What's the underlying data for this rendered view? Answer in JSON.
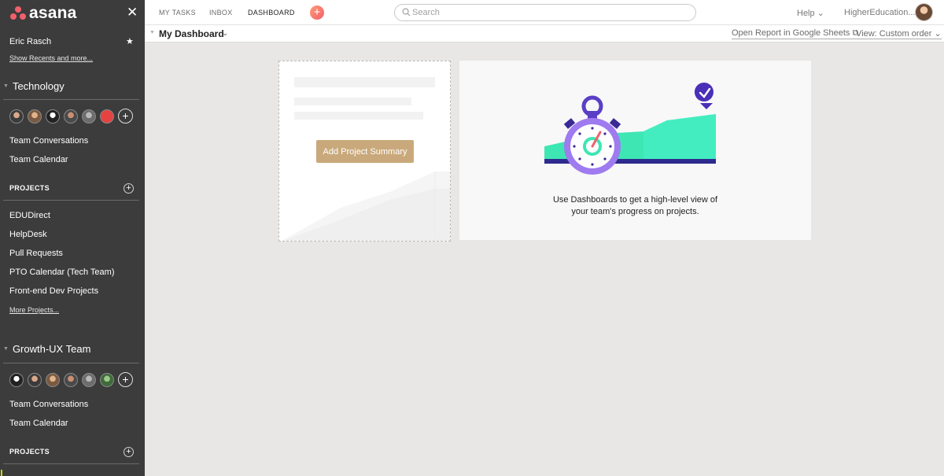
{
  "app": {
    "logo_text": "asana",
    "close_glyph": "✕"
  },
  "sidebar": {
    "user_name": "Eric Rasch",
    "show_recents": "Show Recents and more...",
    "teams": [
      {
        "name": "Technology",
        "links": [
          "Team Conversations",
          "Team Calendar"
        ],
        "projects_label": "PROJECTS",
        "projects": [
          "EDUDirect",
          "HelpDesk",
          "Pull Requests",
          "PTO Calendar (Tech Team)",
          "Front-end Dev Projects"
        ],
        "more_projects": "More Projects..."
      },
      {
        "name": "Growth-UX Team",
        "links": [
          "Team Conversations",
          "Team Calendar"
        ],
        "projects_label": "PROJECTS"
      }
    ]
  },
  "topbar": {
    "tabs": [
      "MY TASKS",
      "INBOX",
      "DASHBOARD"
    ],
    "active_tab": "DASHBOARD",
    "search_placeholder": "Search",
    "help": "Help ⌄",
    "org": "HigherEducation..."
  },
  "subbar": {
    "title": "My Dashboard",
    "report_link": "Open Report in Google Sheets ⧉",
    "view": "View: Custom order ⌄"
  },
  "cards": {
    "add_summary": "Add Project Summary",
    "info_line1": "Use Dashboards to get a high-level view of",
    "info_line2": "your team's progress on projects."
  },
  "colors": {
    "sidebar_bg": "#3c3c3c",
    "brand": "#f2606b",
    "accent_button": "#c9a97b",
    "illustration_green": "#3ee6b3",
    "illustration_purple": "#7f5be0"
  }
}
